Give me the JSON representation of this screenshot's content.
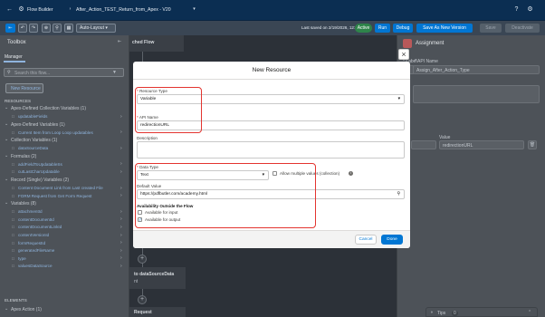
{
  "app": {
    "product": "Flow Builder",
    "flow_title": "After_Action_TEST_Return_from_Apex - V20",
    "last_saved": "Last saved on 2/19/2026, 12:05 AM",
    "status_badge": "Active",
    "run": "Run",
    "debug": "Debug",
    "save_new_version": "Save As New Version",
    "save": "Save",
    "deactivate": "Deactivate"
  },
  "toolbar": {
    "layout": "Auto-Layout"
  },
  "toolbox": {
    "title": "Toolbox",
    "tab": "Manager",
    "search_placeholder": "Search this flow...",
    "new_resource": "New Resource",
    "resources_heading": "RESOURCES",
    "groups": [
      {
        "label": "Apex-Defined Collection Variables (1)",
        "items": [
          "updatableFields"
        ]
      },
      {
        "label": "Apex-Defined Variables (1)",
        "items": [
          "Current Item from Loop Loop updatables"
        ]
      },
      {
        "label": "Collection Variables (1)",
        "items": [
          "dataSourceData"
        ]
      },
      {
        "label": "Formulas (2)",
        "items": [
          "addFieldToUpdatableSs",
          "cutLastCharUpdatable"
        ]
      },
      {
        "label": "Record (Single) Variables (2)",
        "items": [
          "Content Document Link from Last created File",
          "FORM Request from Get Form Request"
        ]
      },
      {
        "label": "Variables (8)",
        "items": [
          "attachmentId",
          "contentDocumentId",
          "contentDocumentLinkId",
          "contentVersionId",
          "formRequestId",
          "generatedFileName",
          "type",
          "valuesDataSource"
        ]
      }
    ],
    "elements_heading": "ELEMENTS",
    "elements_group": "Apex Action (1)"
  },
  "canvas": {
    "frag1": "ched Flow",
    "frag2": "to dataSourceData",
    "frag3": "nt",
    "frag4": "Request"
  },
  "panel": {
    "title": "Assignment",
    "label_label": "* Label",
    "api_name_label": "* API Name",
    "api_name_value": "Assign_After_Action_Type",
    "value_label": "Value",
    "value_value": "redirectionURL"
  },
  "modal": {
    "title": "New Resource",
    "resource_type_label": "Resource Type",
    "resource_type_value": "Variable",
    "api_name_label": "API Name",
    "api_name_value": "redirectionURL",
    "description_label": "Description",
    "data_type_label": "Data Type",
    "data_type_value": "Text",
    "allow_multiple": "Allow multiple values (collection)",
    "default_value_label": "Default Value",
    "default_value": "https://pdfbutler.com/academy.html",
    "availability_heading": "Availability Outside the Flow",
    "available_input": "Available for input",
    "available_output": "Available for output",
    "cancel": "Cancel",
    "done": "Done"
  },
  "tips": {
    "label": "Tips",
    "count": "0"
  },
  "colors": {
    "brand": "#0176d3",
    "highlight": "#e3342f",
    "active": "#2e844a"
  }
}
